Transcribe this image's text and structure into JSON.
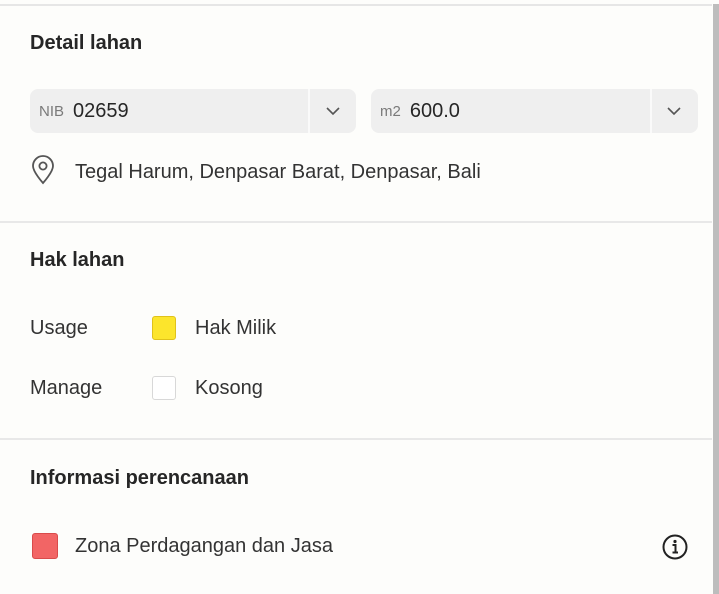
{
  "detail": {
    "title": "Detail lahan",
    "nib": {
      "prefix": "NIB",
      "value": "02659"
    },
    "area": {
      "prefix": "m2",
      "value": "600.0"
    },
    "location": "Tegal Harum, Denpasar Barat, Denpasar, Bali"
  },
  "hak": {
    "title": "Hak lahan",
    "rows": [
      {
        "label": "Usage",
        "value": "Hak Milik",
        "color": "#fce52c",
        "border": "#e0c21a"
      },
      {
        "label": "Manage",
        "value": "Kosong",
        "color": "#ffffff",
        "border": "#d8d8d8"
      }
    ]
  },
  "planning": {
    "title": "Informasi perencanaan",
    "zone": {
      "label": "Zona Perdagangan dan Jasa",
      "color": "#f26565",
      "border": "#d94b4b"
    }
  },
  "icons": [
    "location-pin-icon",
    "chevron-down-icon",
    "info-icon"
  ]
}
